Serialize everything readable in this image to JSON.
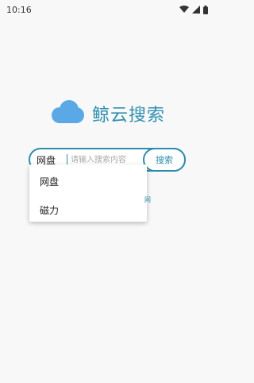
{
  "status_bar": {
    "time": "10:16",
    "icons": [
      "wifi-icon",
      "signal-icon",
      "battery-icon"
    ]
  },
  "app": {
    "logo_icon": "cloud-icon",
    "title": "鲸云搜索",
    "accent_color": "#2d8cab",
    "cloud_color": "#5aa9e6"
  },
  "search": {
    "type_label": "网盘",
    "placeholder": "请输入搜索内容",
    "value": "",
    "button_label": "搜索"
  },
  "dropdown": {
    "items": [
      "网盘",
      "磁力"
    ]
  },
  "hint_text": "网"
}
